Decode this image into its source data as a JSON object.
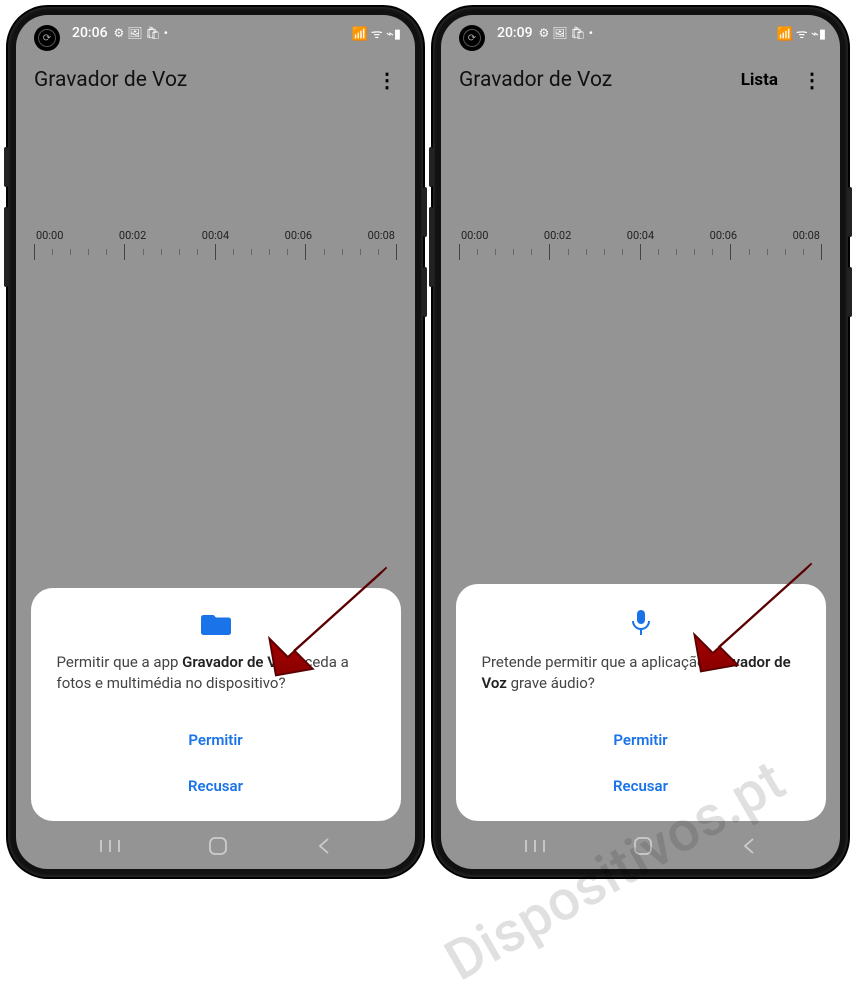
{
  "watermark": "Dispositivos.pt",
  "phones": [
    {
      "status": {
        "time": "20:06",
        "icons_left": "⚙ 🖼 🛍 •",
        "icons_right": "📶 ᯤ ⌁▮"
      },
      "app_bar": {
        "title": "Gravador de Voz",
        "list_label": null
      },
      "timeline": [
        "00:00",
        "00:02",
        "00:04",
        "00:06",
        "00:08"
      ],
      "dialog": {
        "icon": "folder",
        "text_pre": "Permitir que a app ",
        "text_bold": "Gravador de Voz",
        "text_post": " aceda a fotos e multimédia no dispositivo?",
        "allow": "Permitir",
        "deny": "Recusar"
      }
    },
    {
      "status": {
        "time": "20:09",
        "icons_left": "⚙ 🖼 🛍 •",
        "icons_right": "📶 ᯤ ⌁▮"
      },
      "app_bar": {
        "title": "Gravador de Voz",
        "list_label": "Lista"
      },
      "timeline": [
        "00:00",
        "00:02",
        "00:04",
        "00:06",
        "00:08"
      ],
      "dialog": {
        "icon": "mic",
        "text_pre": "Pretende permitir que a aplicação ",
        "text_bold": "Gravador de Voz",
        "text_post": " grave áudio?",
        "allow": "Permitir",
        "deny": "Recusar"
      }
    }
  ]
}
